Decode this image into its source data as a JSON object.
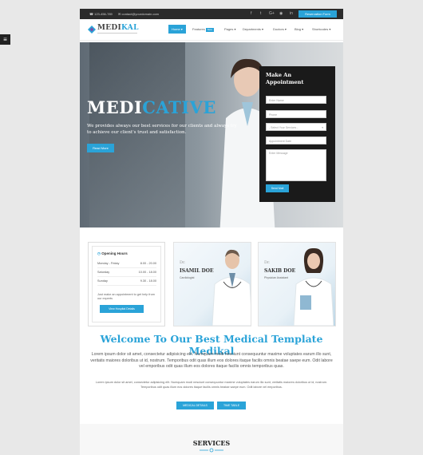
{
  "topbar": {
    "phone": "123-456-789",
    "email": "contact@yourdomain.com",
    "social_icons": [
      "facebook-icon",
      "twitter-icon",
      "google-plus-icon",
      "rss-icon",
      "linkedin-icon"
    ],
    "social_glyphs": [
      "f",
      "t",
      "G+",
      "◉",
      "in"
    ],
    "reserve_label": "Reservation Form"
  },
  "header": {
    "logo_part1": "MEDI",
    "logo_part2": "KAL",
    "nav": [
      {
        "label": "Home",
        "active": true
      },
      {
        "label": "Features",
        "badge": "New"
      },
      {
        "label": "Pages"
      },
      {
        "label": "Departments"
      },
      {
        "label": "Doctors"
      },
      {
        "label": "Blog"
      },
      {
        "label": "Shortcodes"
      }
    ]
  },
  "hero": {
    "title_part1": "MEDI",
    "title_part2": "CATIVE",
    "text": "We provides always our best services for our clients and always try to achieve our client's trust and satisfaction.",
    "button": "Read More"
  },
  "appointment": {
    "title": "Make An Appointment",
    "name_placeholder": "Enter Name",
    "phone_placeholder": "Phone",
    "service_select": "- Select Your Services -",
    "date_placeholder": "Appointment Date",
    "message_placeholder": "Enter Message",
    "submit": "Send Mail"
  },
  "hours": {
    "title": "Opening Hours",
    "rows": [
      {
        "day": "Monday - Friday",
        "time": "8.00 - 20.00"
      },
      {
        "day": "Saturday",
        "time": "10.00 - 18.00"
      },
      {
        "day": "Sunday",
        "time": "9.30 - 18.00"
      }
    ],
    "note": "Just make an appointment to get help from our experts",
    "button": "View Hospital Details"
  },
  "doctors": [
    {
      "prefix": "Dr.",
      "name": "ISAMIL DOE",
      "specialty": "Cardiologist"
    },
    {
      "prefix": "Dr.",
      "name": "SAKIB DOE",
      "specialty": "Physician Assistant"
    }
  ],
  "welcome": {
    "title": "Welcome To Our Best Medical Template Medikal",
    "intro": "Lorem ipsum dolor sit amet, consectetur adipisicing elit. Numquam modi nesciunt consequuntur maxime voluptates earum illo sunt, veritatis maiores doloribus ut id, nostrum. Temporibus odit quas illum eos dolores itaque facilis omnis beatae saepe eum. Odit labore vel emporibus odit quas illum eos dolores itaque facilis omnis temporibus quas.",
    "small": "Lorem ipsum dolor sit amet, consectetur adipisicing elit. Numquam modi nesciunt consequuntur maxime voluptates earum illo sunt, veritatis maiores doloribus ut id, nostrum. Temporibus odit quas illum eos dolores itaque facilis omnis beatae saepe eum. Odit labore vel emporibus.",
    "btn1": "MEDICAL DETAILS",
    "btn2": "TIME TABLE"
  },
  "services": {
    "title": "SERVICES"
  },
  "colors": {
    "accent": "#2aa3d8",
    "dark": "#2b2b2b"
  }
}
